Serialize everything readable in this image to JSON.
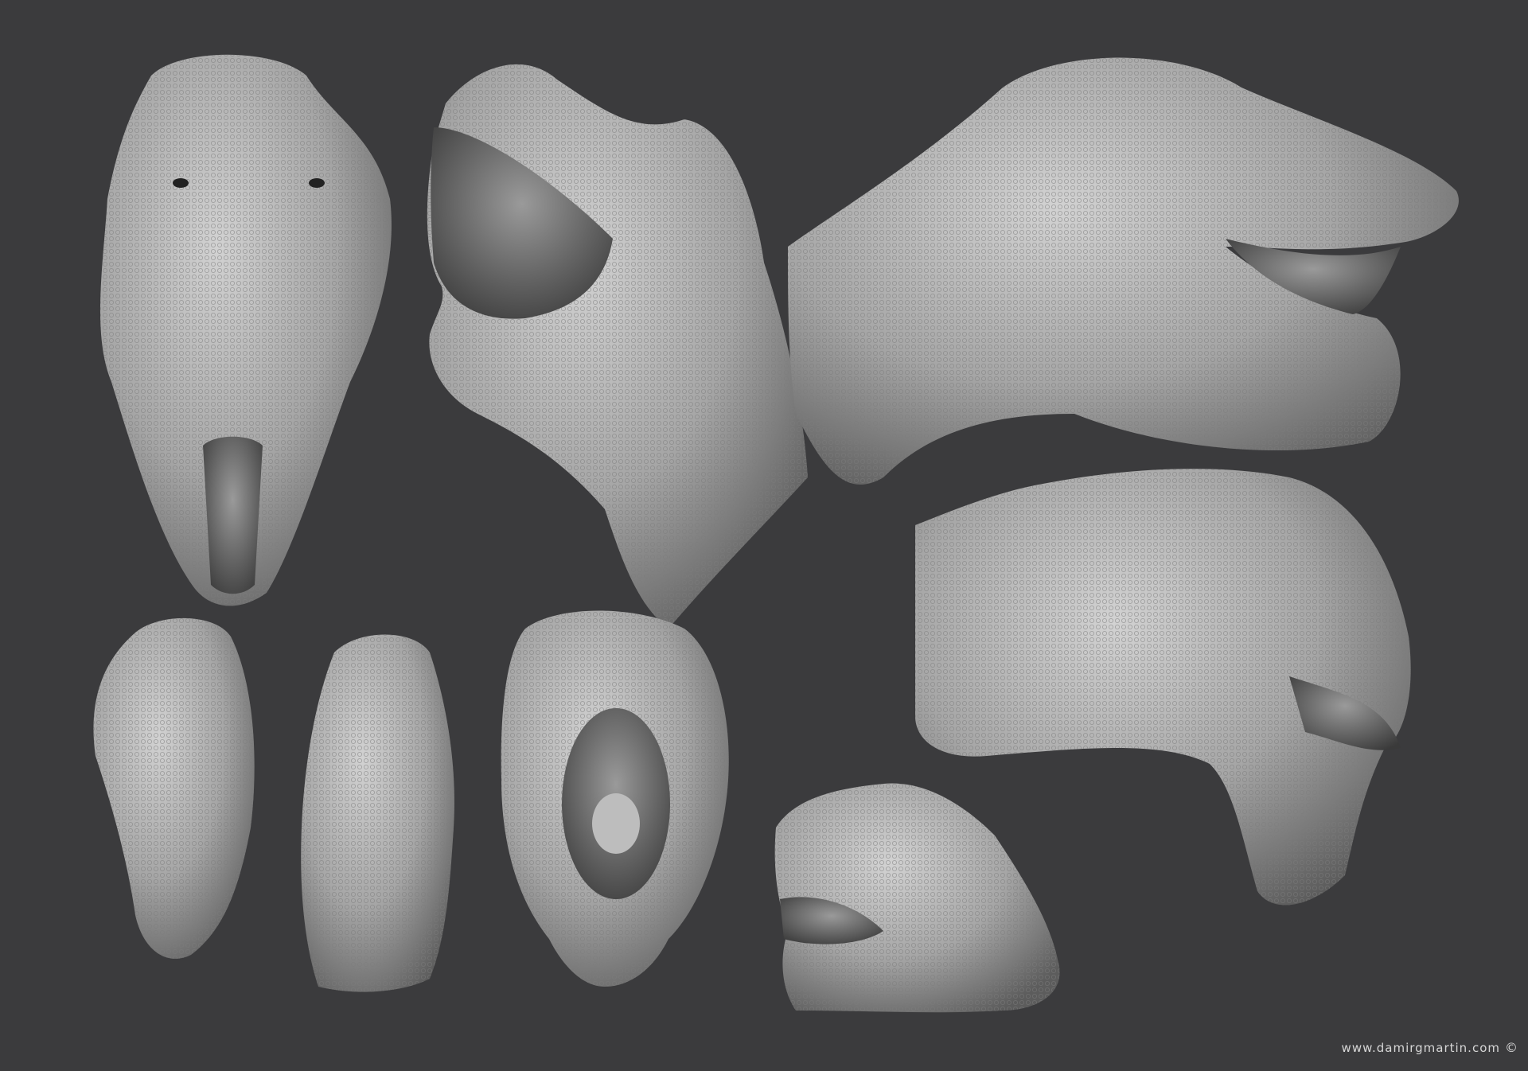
{
  "image": {
    "description_subject": "trex-head-sculpt-turnaround",
    "background_color": "#3b3b3d",
    "clay_color": "#a9a9a9"
  },
  "credit": {
    "text": "www.damirgmartin.com",
    "symbol": "©"
  }
}
